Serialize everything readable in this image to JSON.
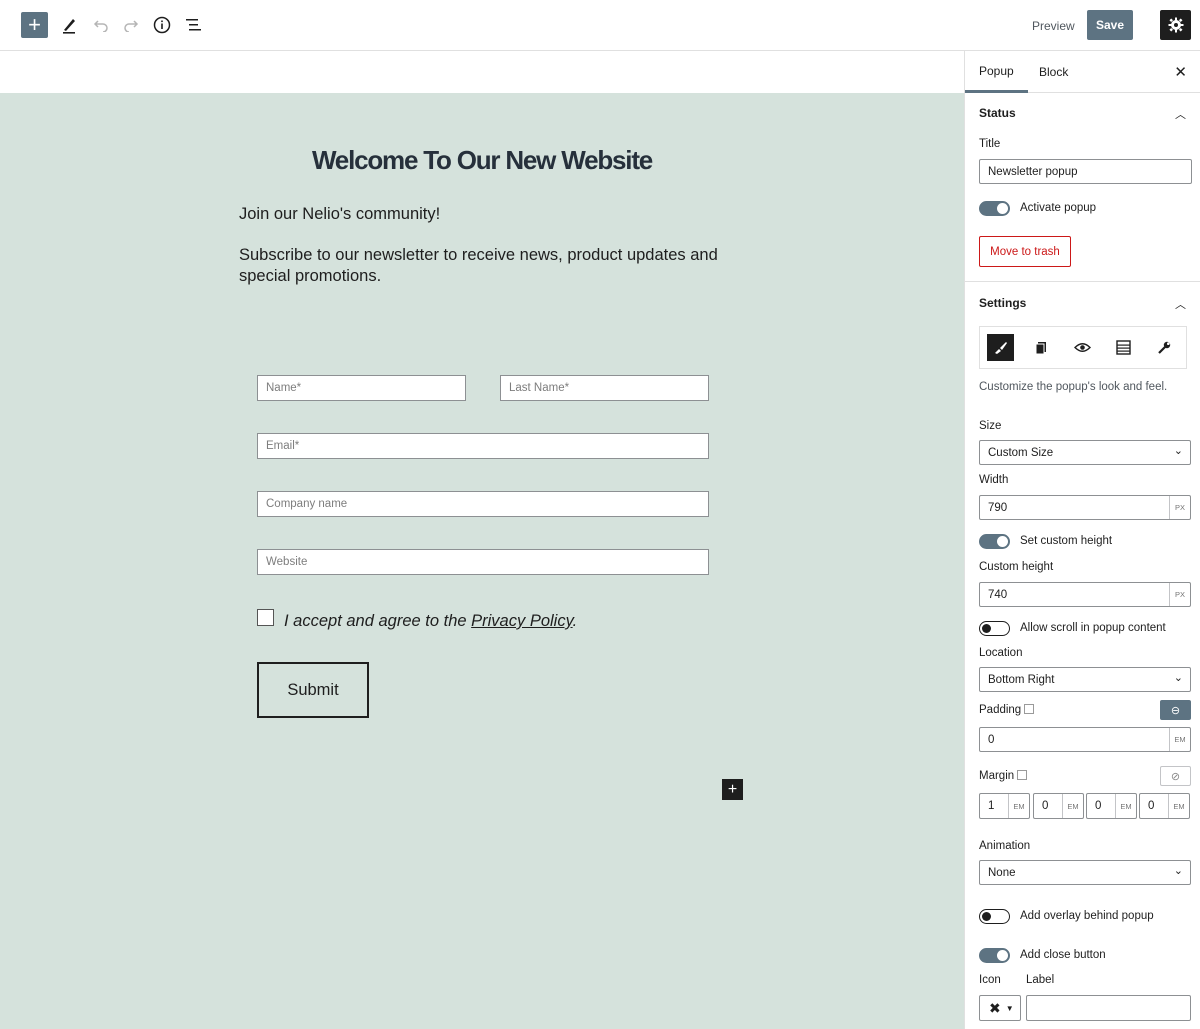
{
  "toolbar": {
    "add_icon": "plus-icon",
    "tools_icon": "pencil-icon",
    "undo_icon": "undo-icon",
    "redo_icon": "redo-icon",
    "details_icon": "info-icon",
    "outline_icon": "list-view-icon",
    "preview_label": "Preview",
    "save_label": "Save",
    "settings_icon": "gear-icon"
  },
  "canvas": {
    "title": "Welcome To Our New Website",
    "intro": "Join our Nelio's community!",
    "subscribe": "Subscribe to our newsletter to receive news, product updates and special promotions.",
    "form": {
      "name_placeholder": "Name*",
      "last_name_placeholder": "Last Name*",
      "email_placeholder": "Email*",
      "company_placeholder": "Company name",
      "website_placeholder": "Website",
      "accept_text": "I accept and agree to the ",
      "privacy_link": "Privacy Policy",
      "accept_end": ".",
      "submit_label": "Submit"
    },
    "background_color": "#d5e2dc"
  },
  "sidebar": {
    "tabs": [
      "Popup",
      "Block"
    ],
    "active_tab": "Popup",
    "status": {
      "heading": "Status",
      "title_label": "Title",
      "title_value": "Newsletter popup",
      "activate_label": "Activate popup",
      "activate_on": true,
      "trash_label": "Move to trash"
    },
    "settings": {
      "heading": "Settings",
      "tab_icons": [
        "brush-icon",
        "copy-icon",
        "eye-icon",
        "table-icon",
        "wrench-icon"
      ],
      "help_text": "Customize the popup's look and feel.",
      "size_label": "Size",
      "size_value": "Custom Size",
      "width_label": "Width",
      "width_value": "790",
      "width_unit": "PX",
      "custom_height_toggle": "Set custom height",
      "custom_height_on": true,
      "custom_height_label": "Custom height",
      "custom_height_value": "740",
      "custom_height_unit": "PX",
      "scroll_toggle": "Allow scroll in popup content",
      "scroll_on": false,
      "location_label": "Location",
      "location_value": "Bottom Right",
      "padding_label": "Padding",
      "padding_value": "0",
      "padding_unit": "EM",
      "margin_label": "Margin",
      "margins": [
        {
          "value": "1",
          "unit": "EM"
        },
        {
          "value": "0",
          "unit": "EM"
        },
        {
          "value": "0",
          "unit": "EM"
        },
        {
          "value": "0",
          "unit": "EM"
        }
      ],
      "animation_label": "Animation",
      "animation_value": "None",
      "overlay_toggle": "Add overlay behind popup",
      "overlay_on": false,
      "close_button_toggle": "Add close button",
      "close_button_on": true,
      "icon_label": "Icon",
      "label_label": "Label",
      "label_value": ""
    }
  },
  "colors": {
    "accent": "#5d7382",
    "danger": "#cc1818",
    "canvas_bg": "#d5e2dc"
  }
}
